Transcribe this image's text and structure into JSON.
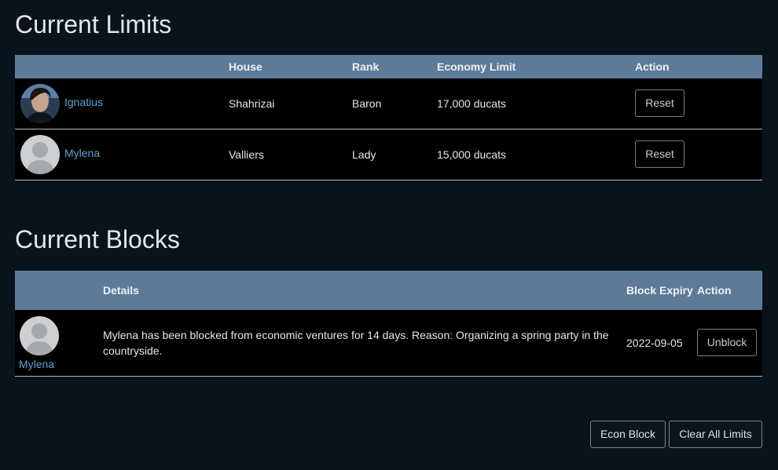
{
  "limits": {
    "title": "Current Limits",
    "headers": {
      "avatar": "",
      "house": "House",
      "rank": "Rank",
      "economy": "Economy Limit",
      "action": "Action"
    },
    "rows": [
      {
        "name": "Ignatius",
        "house": "Shahrizai",
        "rank": "Baron",
        "economy": "17,000 ducats",
        "action": "Reset",
        "avatar": "portrait-photo"
      },
      {
        "name": "Mylena",
        "house": "Valliers",
        "rank": "Lady",
        "economy": "15,000 ducats",
        "action": "Reset",
        "avatar": "default-user-silhouette"
      }
    ]
  },
  "blocks": {
    "title": "Current Blocks",
    "headers": {
      "avatar": "",
      "details": "Details",
      "expiry": "Block Expiry",
      "action": "Action"
    },
    "rows": [
      {
        "name": "Mylena",
        "details": "Mylena has been blocked from economic ventures for 14 days. Reason: Organizing a spring party in the countryside.",
        "expiry": "2022-09-05",
        "action": "Unblock",
        "avatar": "default-user-silhouette"
      }
    ]
  },
  "footer": {
    "econ_block": "Econ Block",
    "clear_all": "Clear All Limits"
  },
  "colors": {
    "background": "#08141b",
    "header": "#5d7a98",
    "link": "#5aa3d8",
    "row": "#000000"
  }
}
